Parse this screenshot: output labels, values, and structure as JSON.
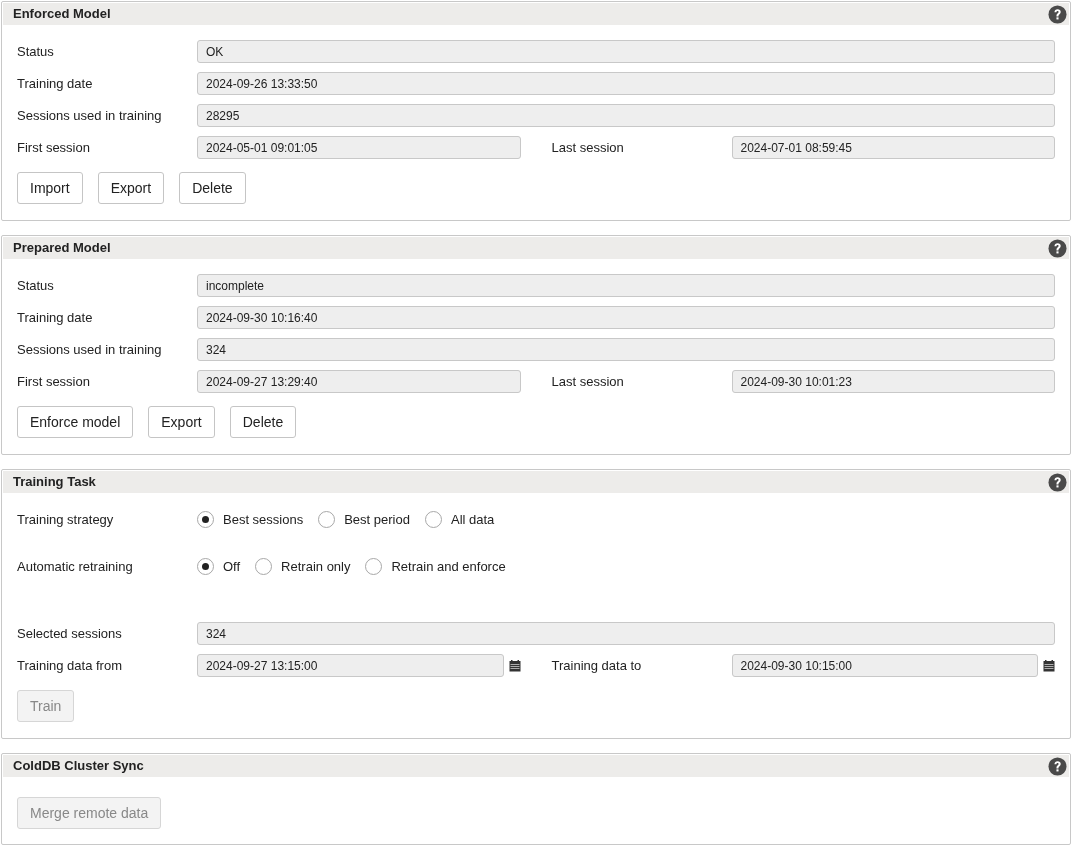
{
  "panels": [
    {
      "title": "Enforced Model",
      "rows": [
        {
          "kind": "field",
          "label": "Status",
          "value": "OK"
        },
        {
          "kind": "field",
          "label": "Training date",
          "value": "2024-09-26 13:33:50"
        },
        {
          "kind": "field",
          "label": "Sessions used in training",
          "value": "28295"
        },
        {
          "kind": "pair",
          "fields": [
            {
              "label": "First session",
              "value": "2024-05-01 09:01:05"
            },
            {
              "label": "Last session",
              "value": "2024-07-01 08:59:45"
            }
          ]
        }
      ],
      "buttons": [
        {
          "label": "Import",
          "disabled": false
        },
        {
          "label": "Export",
          "disabled": false
        },
        {
          "label": "Delete",
          "disabled": false
        }
      ]
    },
    {
      "title": "Prepared Model",
      "rows": [
        {
          "kind": "field",
          "label": "Status",
          "value": "incomplete"
        },
        {
          "kind": "field",
          "label": "Training date",
          "value": "2024-09-30 10:16:40"
        },
        {
          "kind": "field",
          "label": "Sessions used in training",
          "value": "324"
        },
        {
          "kind": "pair",
          "fields": [
            {
              "label": "First session",
              "value": "2024-09-27 13:29:40"
            },
            {
              "label": "Last session",
              "value": "2024-09-30 10:01:23"
            }
          ]
        }
      ],
      "buttons": [
        {
          "label": "Enforce model",
          "disabled": false
        },
        {
          "label": "Export",
          "disabled": false
        },
        {
          "label": "Delete",
          "disabled": false
        }
      ]
    },
    {
      "title": "Training Task",
      "rows": [
        {
          "kind": "radios",
          "label": "Training strategy",
          "options": [
            {
              "label": "Best sessions",
              "selected": true
            },
            {
              "label": "Best period",
              "selected": false
            },
            {
              "label": "All data",
              "selected": false
            }
          ]
        },
        {
          "kind": "radios",
          "label": "Automatic retraining",
          "options": [
            {
              "label": "Off",
              "selected": true
            },
            {
              "label": "Retrain only",
              "selected": false
            },
            {
              "label": "Retrain and enforce",
              "selected": false
            }
          ]
        },
        {
          "kind": "field",
          "label": "Selected sessions",
          "value": "324"
        },
        {
          "kind": "date_pair",
          "fields": [
            {
              "label": "Training data from",
              "value": "2024-09-27 13:15:00"
            },
            {
              "label": "Training data to",
              "value": "2024-09-30 10:15:00"
            }
          ]
        }
      ],
      "buttons": [
        {
          "label": "Train",
          "disabled": true
        }
      ]
    },
    {
      "title": "ColdDB Cluster Sync",
      "buttons": [
        {
          "label": "Merge remote data",
          "disabled": true
        }
      ]
    }
  ]
}
